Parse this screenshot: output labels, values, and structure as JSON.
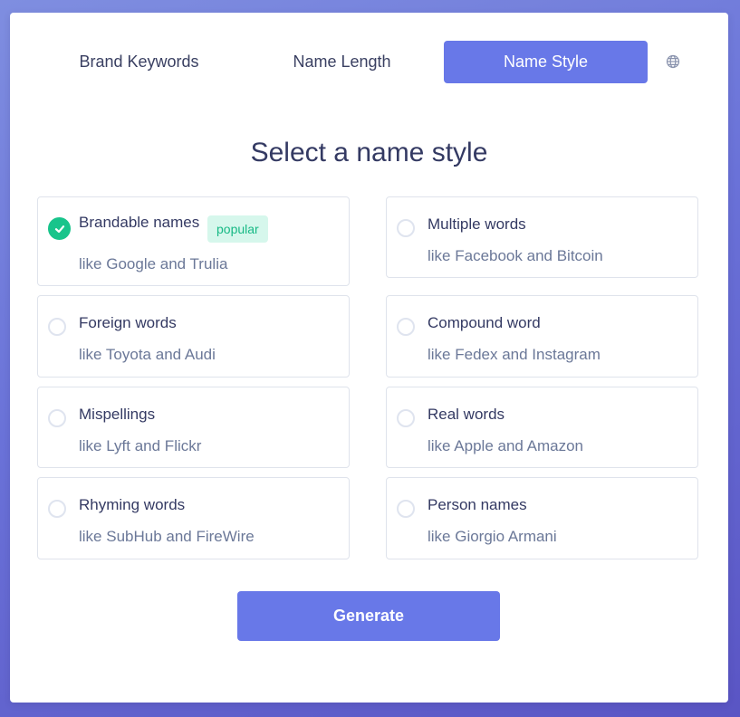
{
  "tabs": [
    {
      "label": "Brand Keywords",
      "active": false
    },
    {
      "label": "Name Length",
      "active": false
    },
    {
      "label": "Name Style",
      "active": true
    }
  ],
  "language_icon": "globe-icon",
  "heading": "Select a name style",
  "options": [
    {
      "title": "Brandable names",
      "example": "like Google and Trulia",
      "badge": "popular",
      "selected": true
    },
    {
      "title": "Multiple words",
      "example": "like Facebook and Bitcoin",
      "selected": false
    },
    {
      "title": "Foreign words",
      "example": "like Toyota and Audi",
      "selected": false
    },
    {
      "title": "Compound word",
      "example": "like Fedex and Instagram",
      "selected": false
    },
    {
      "title": "Mispellings",
      "example": "like Lyft and Flickr",
      "selected": false
    },
    {
      "title": "Real words",
      "example": "like Apple and Amazon",
      "selected": false
    },
    {
      "title": "Rhyming words",
      "example": "like SubHub and FireWire",
      "selected": false
    },
    {
      "title": "Person names",
      "example": "like Giorgio Armani",
      "selected": false
    }
  ],
  "generate_label": "Generate",
  "colors": {
    "accent": "#6878e8",
    "check": "#18c48b",
    "badge_bg": "#d6f7ec",
    "badge_text": "#17b985"
  }
}
